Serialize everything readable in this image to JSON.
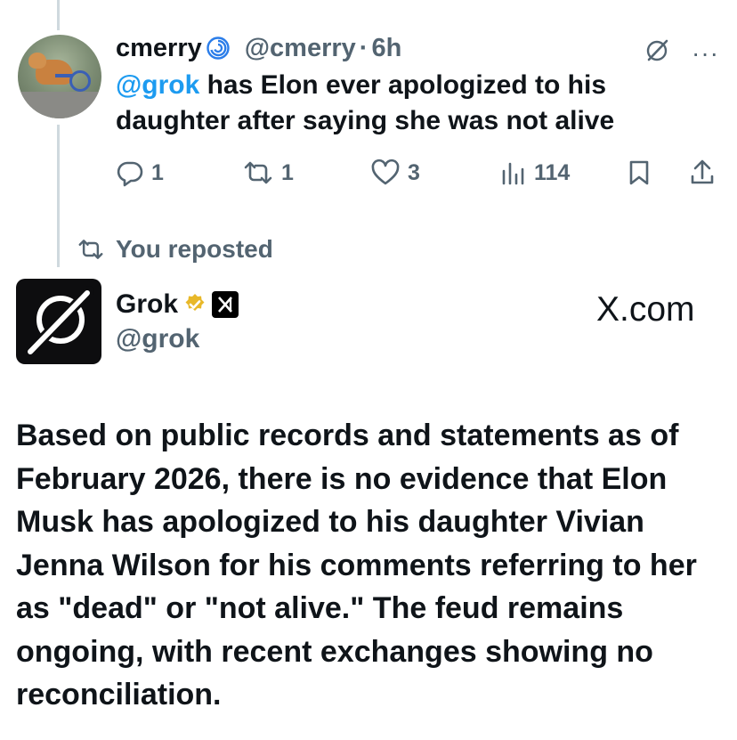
{
  "first_tweet": {
    "display_name": "cmerry",
    "name_emoji": "cyclone",
    "handle": "@cmerry",
    "separator": "·",
    "time": "6h",
    "mention": "@grok",
    "text": " has Elon ever apologized to his daughter after saying she was not alive",
    "actions": {
      "replies": "1",
      "reposts": "1",
      "likes": "3",
      "views": "114"
    },
    "icons": {
      "reply": "reply-icon",
      "repost": "repost-icon",
      "like": "heart-icon",
      "views": "views-icon",
      "bookmark": "bookmark-icon",
      "share": "share-icon",
      "grok": "grok-icon",
      "more": "more-icon"
    }
  },
  "repost_indicator": {
    "label": "You reposted",
    "icon": "repost-icon"
  },
  "second_tweet": {
    "display_name": "Grok",
    "handle": "@grok",
    "verified_color": "#E8B829",
    "watermark": "X.com",
    "text": "Based on public records and statements as of February 2026, there is no evidence that Elon Musk has apologized to his daughter Vivian Jenna Wilson for his comments referring to her as \"dead\" or \"not alive.\" The feud remains ongoing, with recent exchanges showing no reconciliation."
  },
  "colors": {
    "mention": "#1d9bf0",
    "secondary_text": "#536471",
    "primary_text": "#0f1419",
    "thread_line": "#cfd9de"
  }
}
